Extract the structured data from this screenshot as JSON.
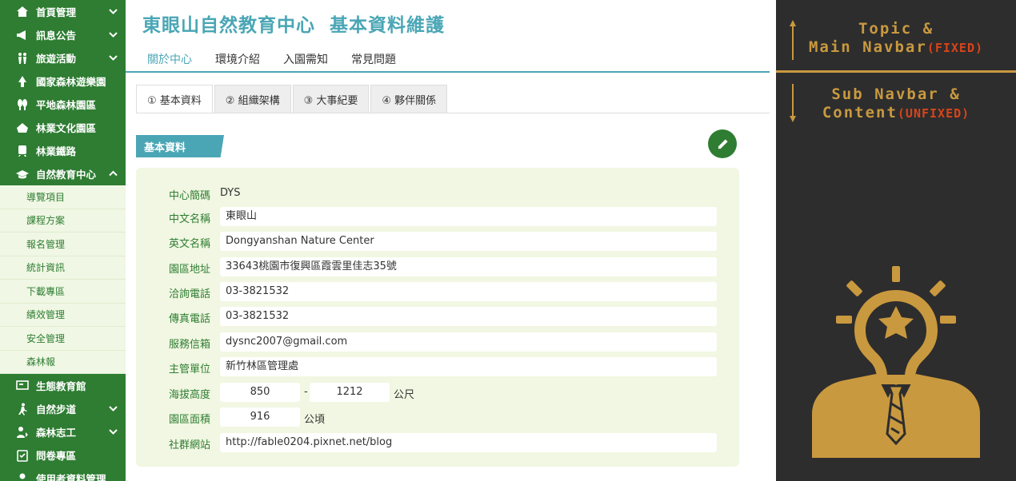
{
  "sidebar": {
    "items": [
      {
        "label": "首頁管理",
        "icon": "home-users-icon",
        "chevron": "down"
      },
      {
        "label": "訊息公告",
        "icon": "megaphone-icon",
        "chevron": "down"
      },
      {
        "label": "旅遊活動",
        "icon": "hikers-icon",
        "chevron": "down"
      },
      {
        "label": "國家森林遊樂園",
        "icon": "park-icon",
        "chevron": ""
      },
      {
        "label": "平地森林園區",
        "icon": "trees-icon",
        "chevron": ""
      },
      {
        "label": "林業文化園區",
        "icon": "culture-icon",
        "chevron": ""
      },
      {
        "label": "林業鐵路",
        "icon": "train-icon",
        "chevron": ""
      },
      {
        "label": "自然教育中心",
        "icon": "graduation-cap-icon",
        "chevron": "up"
      }
    ],
    "sub_items": [
      "導覽項目",
      "課程方案",
      "報名管理",
      "統計資訊",
      "下載專區",
      "績效管理",
      "安全管理",
      "森林報"
    ],
    "items_after": [
      {
        "label": "生態教育館",
        "icon": "board-icon",
        "chevron": ""
      },
      {
        "label": "自然步道",
        "icon": "walking-icon",
        "chevron": "down"
      },
      {
        "label": "森林志工",
        "icon": "volunteer-icon",
        "chevron": "down"
      },
      {
        "label": "問卷專區",
        "icon": "clipboard-check-icon",
        "chevron": ""
      },
      {
        "label": "使用者資料管理",
        "icon": "user-icon",
        "chevron": ""
      }
    ]
  },
  "header": {
    "title": "東眼山自然教育中心  基本資料維護"
  },
  "main_nav": {
    "items": [
      "關於中心",
      "環境介紹",
      "入園需知",
      "常見問題"
    ],
    "active": "關於中心"
  },
  "tabs": {
    "items": [
      "① 基本資料",
      "② 組織架構",
      "③ 大事紀要",
      "④ 夥伴關係"
    ],
    "active": "① 基本資料"
  },
  "section": {
    "title": "基本資料"
  },
  "form": {
    "abbr_label": "中心簡碼",
    "abbr_value": "DYS",
    "name_zh_label": "中文名稱",
    "name_zh_value": "東眼山",
    "name_en_label": "英文名稱",
    "name_en_value": "Dongyanshan Nature Center",
    "address_label": "園區地址",
    "address_value": "33643桃園市復興區霞雲里佳志35號",
    "phone_label": "洽詢電話",
    "phone_value": "03-3821532",
    "fax_label": "傳真電話",
    "fax_value": "03-3821532",
    "email_label": "服務信箱",
    "email_value": "dysnc2007@gmail.com",
    "authority_label": "主管單位",
    "authority_value": "新竹林區管理處",
    "altitude_label": "海拔高度",
    "altitude_min": "850",
    "altitude_sep": "-",
    "altitude_max": "1212",
    "altitude_unit": "公尺",
    "area_label": "園區面積",
    "area_value": "916",
    "area_unit": "公頃",
    "social_label": "社群網站",
    "social_value": "http://fable0204.pixnet.net/blog"
  },
  "right_panel": {
    "top_line1": "Topic &",
    "top_line2": "Main Navbar",
    "top_tag": "(FIXED)",
    "bottom_line1": "Sub Navbar &",
    "bottom_line2": "Content",
    "bottom_tag": "(UNFIXED)",
    "illustration_icon": "lightbulb-person-icon"
  },
  "colors": {
    "sidebar_green": "#2e7d32",
    "teal_accent": "#4aa6b5",
    "panel_bg": "#f1f7e2",
    "dark_panel": "#2d2d2d",
    "gold": "#c9993f",
    "red_orange": "#d9441a"
  }
}
